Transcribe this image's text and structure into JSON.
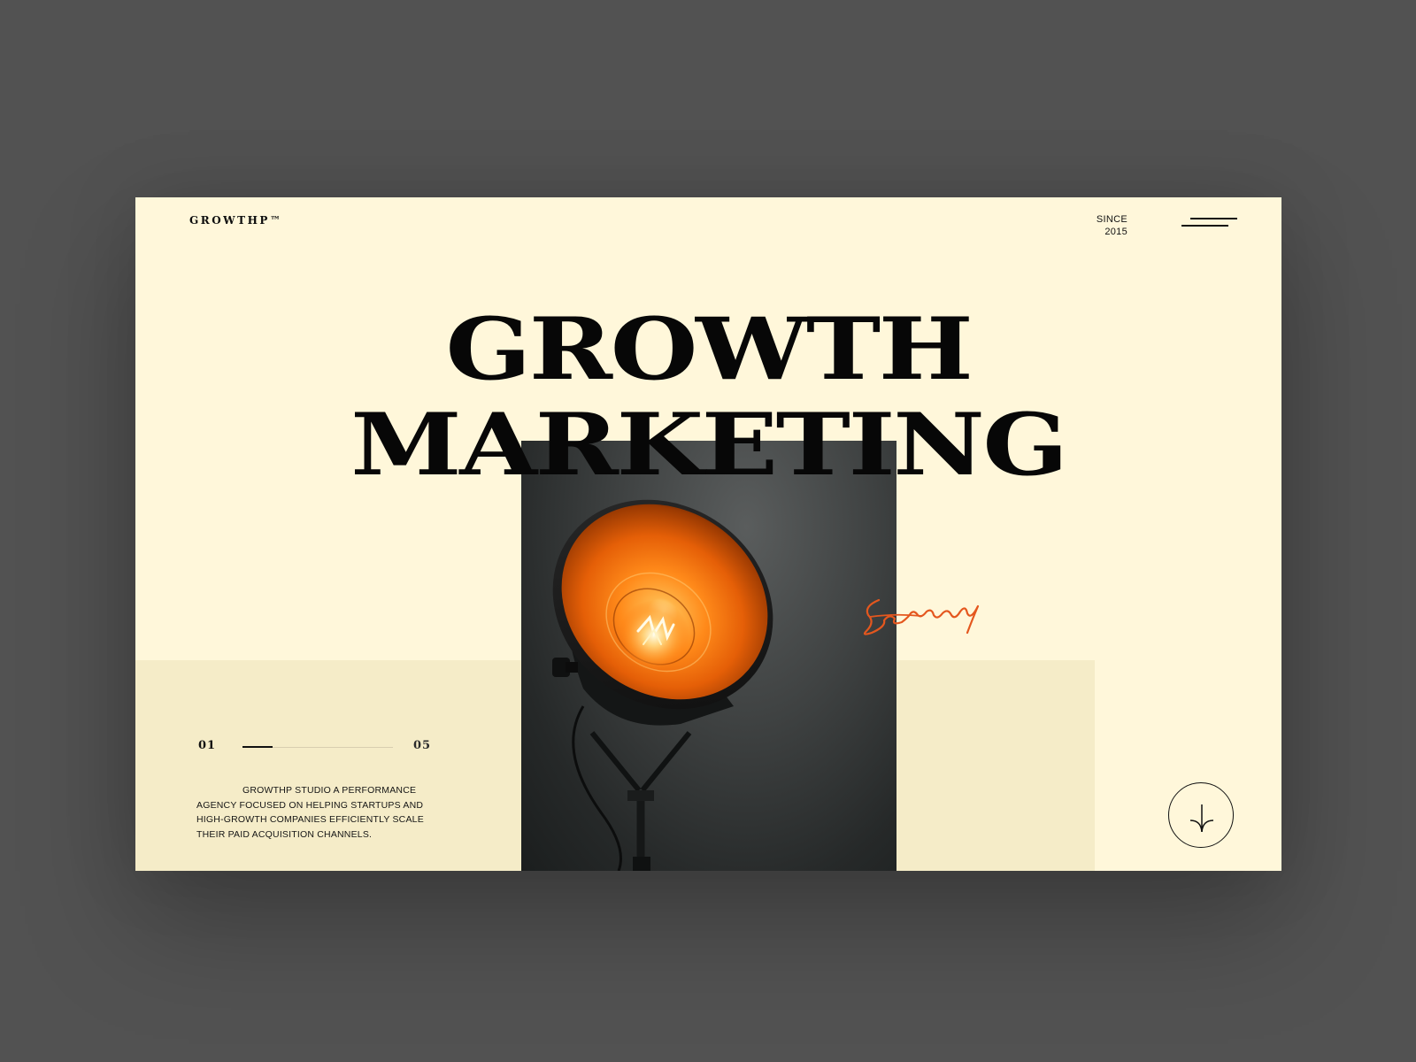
{
  "brand": {
    "logo": "GROWTHP™"
  },
  "header": {
    "since_label": "SINCE",
    "since_year": "2015"
  },
  "hero": {
    "headline_line1": "GROWTH",
    "headline_line2": "MARKETING",
    "signature_icon": "handwritten-signature"
  },
  "pager": {
    "current": "01",
    "total": "05",
    "progress": 0.2
  },
  "description": "GROWTHP STUDIO A PERFORMANCE AGENCY FOCUSED ON HELPING STARTUPS AND HIGH-GROWTH COMPANIES EFFICIENTLY SCALE THEIR PAID ACQUISITION CHANNELS.",
  "icons": {
    "menu": "hamburger-menu-icon",
    "scroll": "arrow-down-icon"
  },
  "colors": {
    "background": "#fff7da",
    "band": "#f5ecc8",
    "text": "#070707",
    "accent": "#e4571e",
    "frame": "#525252"
  }
}
